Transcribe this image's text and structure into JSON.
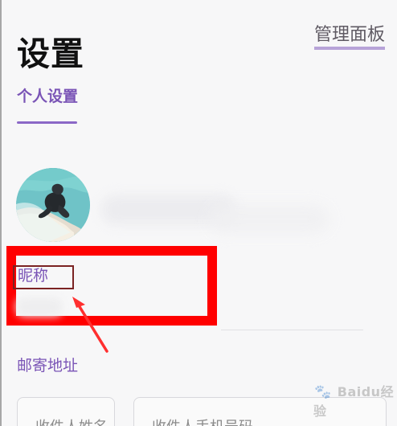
{
  "header": {
    "title": "设置",
    "admin_link": "管理面板"
  },
  "tabs": {
    "active_label": "个人设置"
  },
  "profile": {
    "nickname_label": "昵称",
    "mailing_address_label": "邮寄地址"
  },
  "form": {
    "recipient_name_placeholder": "收件人姓名",
    "recipient_phone_placeholder": "收件人手机号码"
  },
  "overlay": {
    "watermark_text": "Baidu经验"
  },
  "colors": {
    "accent": "#7a54b6",
    "highlight": "#ff0000",
    "arrow": "#ff2f2f"
  },
  "icons": {
    "avatar": "user-avatar-image",
    "arrow": "callout-arrow-icon",
    "watermark": "baidu-paw-logo"
  }
}
